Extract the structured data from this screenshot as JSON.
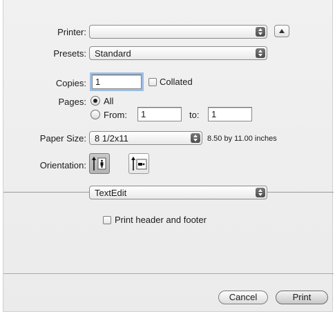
{
  "printer": {
    "label": "Printer:",
    "value": ""
  },
  "presets": {
    "label": "Presets:",
    "value": "Standard"
  },
  "copies": {
    "label": "Copies:",
    "value": "1",
    "collated_label": "Collated",
    "collated": false
  },
  "pages": {
    "label": "Pages:",
    "all_label": "All",
    "from_label": "From:",
    "from_value": "1",
    "to_label": "to:",
    "to_value": "1",
    "selected": "All"
  },
  "paper_size": {
    "label": "Paper Size:",
    "value": "8 1/2x11",
    "dimensions": "8.50 by 11.00 inches"
  },
  "orientation": {
    "label": "Orientation:",
    "selected": "portrait"
  },
  "panel": {
    "value": "TextEdit"
  },
  "print_header_footer": {
    "label": "Print header and footer",
    "checked": false
  },
  "buttons": {
    "cancel": "Cancel",
    "print": "Print"
  }
}
